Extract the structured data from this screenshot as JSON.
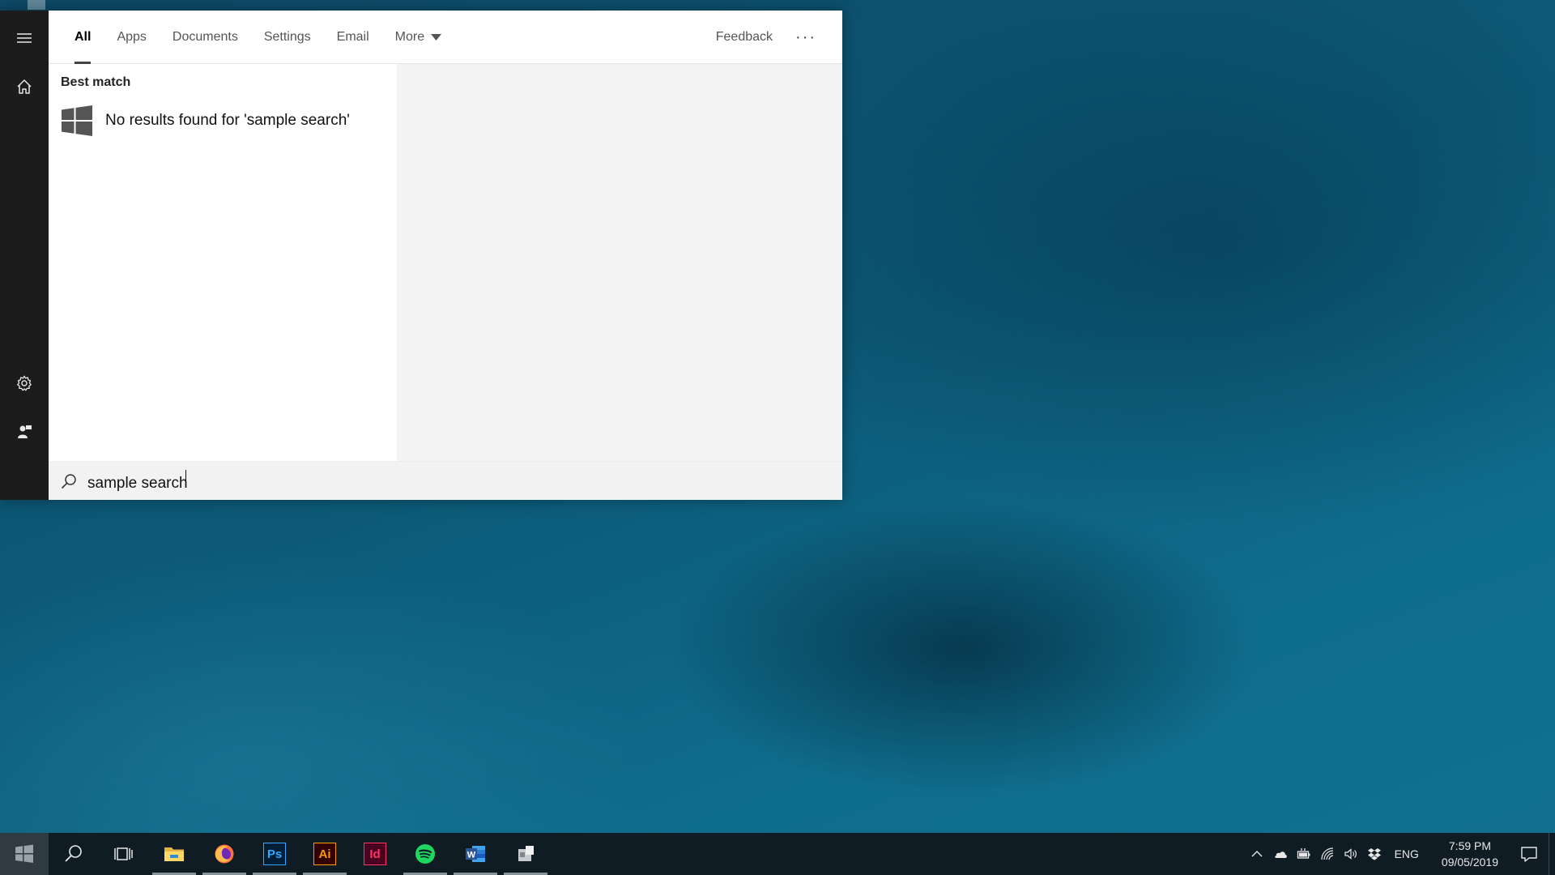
{
  "tabs": {
    "all": "All",
    "apps": "Apps",
    "documents": "Documents",
    "settings": "Settings",
    "email": "Email",
    "more": "More"
  },
  "header": {
    "feedback": "Feedback",
    "more_options": "···"
  },
  "results": {
    "section_heading": "Best match",
    "no_results": "No results found for 'sample search'"
  },
  "search": {
    "query": "sample search"
  },
  "rail": {
    "icons": [
      "hamburger-menu-icon",
      "home-icon",
      "gear-icon",
      "user-feedback-icon"
    ]
  },
  "taskbar": {
    "apps": [
      {
        "name": "file-explorer",
        "label": ""
      },
      {
        "name": "firefox",
        "label": ""
      },
      {
        "name": "photoshop",
        "label": "Ps"
      },
      {
        "name": "illustrator",
        "label": "Ai"
      },
      {
        "name": "indesign",
        "label": "Id"
      },
      {
        "name": "spotify",
        "label": ""
      },
      {
        "name": "word",
        "label": "W"
      },
      {
        "name": "installer",
        "label": ""
      }
    ],
    "language": "ENG",
    "time": "7:59 PM",
    "date": "09/05/2019"
  },
  "colors": {
    "photoshop_bg": "#001e36",
    "photoshop_fg": "#31a8ff",
    "illustrator_bg": "#330000",
    "illustrator_fg": "#ff9a00",
    "indesign_bg": "#49021f",
    "indesign_fg": "#ff3366",
    "spotify": "#1ed760",
    "word": "#2b579a"
  }
}
